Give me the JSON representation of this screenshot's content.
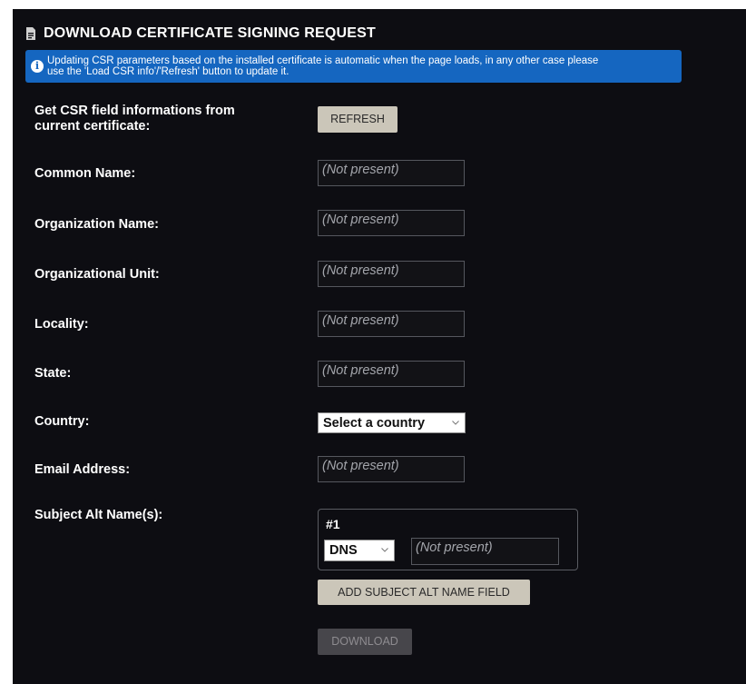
{
  "section": {
    "title": "DOWNLOAD CERTIFICATE SIGNING REQUEST",
    "icon": "document-icon"
  },
  "info": {
    "icon": "info-icon",
    "line1": "Updating CSR parameters based on the installed certificate is automatic when the page loads, in any other case please",
    "line2": "use the 'Load CSR info'/'Refresh' button to update it."
  },
  "refresh": {
    "label_line1": "Get CSR field informations from",
    "label_line2": "current certificate:",
    "button": "REFRESH"
  },
  "fields": {
    "common_name": {
      "label": "Common Name:",
      "value": "(Not present)"
    },
    "organization_name": {
      "label": "Organization Name:",
      "value": "(Not present)"
    },
    "organizational_unit": {
      "label": "Organizational Unit:",
      "value": "(Not present)"
    },
    "locality": {
      "label": "Locality:",
      "value": "(Not present)"
    },
    "state": {
      "label": "State:",
      "value": "(Not present)"
    },
    "country": {
      "label": "Country:",
      "selected": "Select a country"
    },
    "email": {
      "label": "Email Address:",
      "value": "(Not present)"
    }
  },
  "san": {
    "label": "Subject Alt Name(s):",
    "entry_number": "#1",
    "type_selected": "DNS",
    "value": "(Not present)",
    "add_button": "ADD SUBJECT ALT NAME FIELD"
  },
  "download_button": "DOWNLOAD",
  "colors": {
    "panel_bg": "#0d0d12",
    "info_bg": "#1566c0",
    "button_bg": "#cbc6b9",
    "button_disabled_bg": "#47464b"
  }
}
